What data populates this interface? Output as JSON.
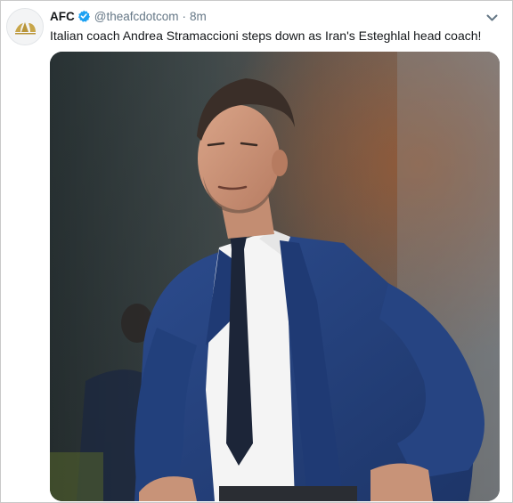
{
  "tweet": {
    "author_name": "AFC",
    "handle": "@theafcdotcom",
    "separator": "·",
    "timestamp": "8m",
    "text": "Italian coach Andrea Stramaccioni steps down as Iran's Esteghlal head coach!",
    "avatar_icon": "afc-logo-icon",
    "verified_icon": "verified-badge-icon",
    "menu_icon": "chevron-down-icon"
  },
  "media": {
    "type": "photo",
    "icon": "photo"
  },
  "colors": {
    "text_primary": "#14171a",
    "text_secondary": "#657786",
    "verified_blue": "#1da1f2",
    "border": "#e1e8ed"
  }
}
